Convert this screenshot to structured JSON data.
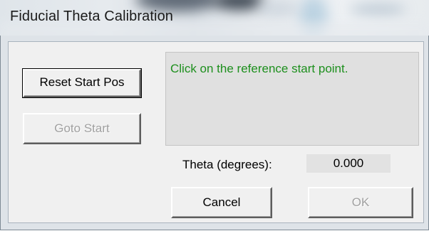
{
  "window": {
    "title": "Fiducial Theta Calibration"
  },
  "buttons": {
    "reset_start_pos": "Reset Start Pos",
    "goto_start": "Goto Start",
    "cancel": "Cancel",
    "ok": "OK"
  },
  "message": {
    "text": "Click on the reference start point."
  },
  "theta": {
    "label": "Theta (degrees):",
    "value": "0.000"
  },
  "state": {
    "goto_start_enabled": false,
    "ok_enabled": false,
    "default_button": "reset_start_pos"
  },
  "colors": {
    "message_text": "#1d8f1d",
    "dialog_background": "#f0f0f0",
    "message_background": "#e0e0e0",
    "disabled_text": "#a0a0a0"
  }
}
